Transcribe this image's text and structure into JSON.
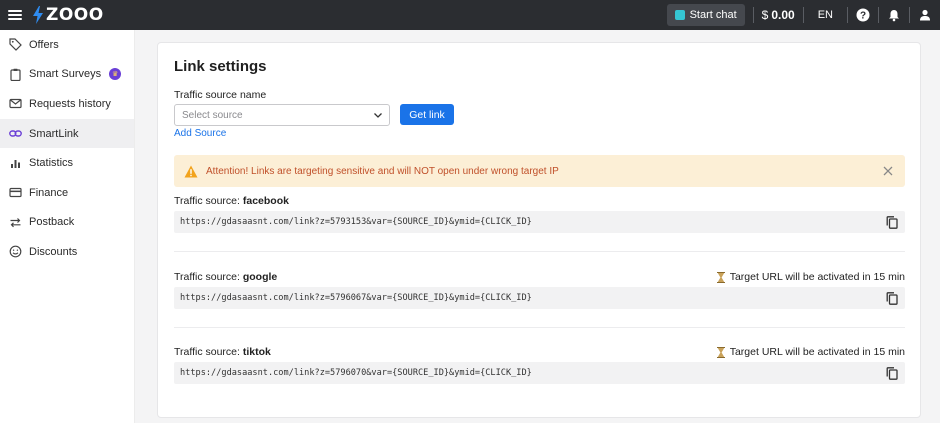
{
  "topbar": {
    "logo_text": "ZOOO",
    "start_chat": "Start chat",
    "balance_currency": "$",
    "balance_value": "0.00",
    "language": "EN",
    "icons": [
      "menu-icon",
      "help-icon",
      "bell-icon",
      "user-icon"
    ]
  },
  "sidebar": {
    "items": [
      {
        "label": "Offers",
        "icon": "tag-icon"
      },
      {
        "label": "Smart Surveys",
        "icon": "clipboard-icon"
      },
      {
        "label": "Requests history",
        "icon": "mail-icon"
      },
      {
        "label": "SmartLink",
        "icon": "link-icon",
        "active": true
      },
      {
        "label": "Statistics",
        "icon": "bar-chart-icon"
      },
      {
        "label": "Finance",
        "icon": "card-icon"
      },
      {
        "label": "Postback",
        "icon": "swap-icon"
      },
      {
        "label": "Discounts",
        "icon": "smile-icon"
      }
    ]
  },
  "main": {
    "title": "Link settings",
    "field_label": "Traffic source name",
    "select_placeholder": "Select source",
    "get_link": "Get link",
    "add_source": "Add Source",
    "alert": "Attention! Links are targeting sensitive and will NOT open under wrong target IP",
    "sources": [
      {
        "prefix": "Traffic source: ",
        "name": "facebook",
        "url": "https://gdasaasnt.com/link?z=5793153&var={SOURCE_ID}&ymid={CLICK_ID}",
        "timer": ""
      },
      {
        "prefix": "Traffic source: ",
        "name": "google",
        "url": "https://gdasaasnt.com/link?z=5796067&var={SOURCE_ID}&ymid={CLICK_ID}",
        "timer": "Target URL will be activated in 15 min"
      },
      {
        "prefix": "Traffic source: ",
        "name": "tiktok",
        "url": "https://gdasaasnt.com/link?z=5796070&var={SOURCE_ID}&ymid={CLICK_ID}",
        "timer": "Target URL will be activated in 15 min"
      }
    ]
  },
  "colors": {
    "topbar_bg": "#2b2d31",
    "accent": "#1a73e8",
    "alert_bg": "#fcefd6",
    "alert_text": "#c0502a",
    "logo_bolt": "#2f8cf0"
  }
}
